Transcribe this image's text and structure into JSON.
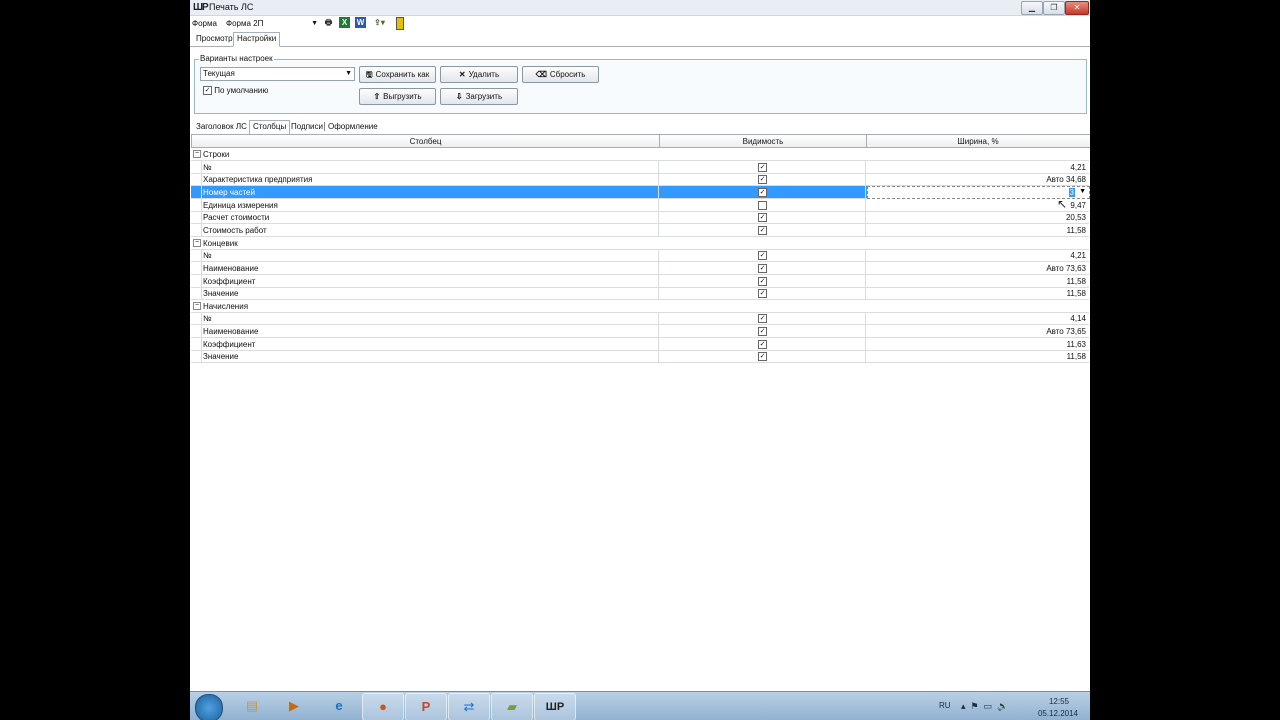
{
  "window": {
    "title": "Печать ЛС",
    "app_icon": "ШР"
  },
  "form_row": {
    "label": "Форма",
    "selected": "Форма 2П"
  },
  "toolbar_icons": [
    "printer-icon",
    "excel-icon",
    "word-icon",
    "export-icon",
    "bookmark-icon"
  ],
  "top_tabs": [
    {
      "label": "Просмотр",
      "active": false
    },
    {
      "label": "Настройки",
      "active": true
    }
  ],
  "settings": {
    "group_title": "Варианты настроек",
    "variant_value": "Текущая",
    "default_label": "По умолчанию",
    "default_checked": true,
    "buttons": {
      "save_as": "Сохранить как",
      "delete": "Удалить",
      "reset": "Сбросить",
      "export": "Выгрузить",
      "import": "Загрузить"
    }
  },
  "inner_tabs": [
    {
      "label": "Заголовок ЛС",
      "active": false
    },
    {
      "label": "Столбцы",
      "active": true
    },
    {
      "label": "Подписи",
      "active": false
    },
    {
      "label": "Оформление",
      "active": false
    }
  ],
  "grid": {
    "columns": [
      "Столбец",
      "Видимость",
      "Ширина, %"
    ],
    "groups": [
      {
        "name": "Строки",
        "rows": [
          {
            "name": "№",
            "visible": true,
            "width": "4,21"
          },
          {
            "name": "Характеристика предприятия",
            "visible": true,
            "width": "Авто 34,68"
          },
          {
            "name": "Номер частей",
            "visible": true,
            "width": "3",
            "selected": true
          },
          {
            "name": "Единица измерения",
            "visible": false,
            "width": "9,47"
          },
          {
            "name": "Расчет стоимости",
            "visible": true,
            "width": "20,53"
          },
          {
            "name": "Стоимость работ",
            "visible": true,
            "width": "11,58"
          }
        ]
      },
      {
        "name": "Концевик",
        "rows": [
          {
            "name": "№",
            "visible": true,
            "width": "4,21"
          },
          {
            "name": "Наименование",
            "visible": true,
            "width": "Авто 73,63"
          },
          {
            "name": "Коэффициент",
            "visible": true,
            "width": "11,58"
          },
          {
            "name": "Значение",
            "visible": true,
            "width": "11,58"
          }
        ]
      },
      {
        "name": "Начисления",
        "rows": [
          {
            "name": "№",
            "visible": true,
            "width": "4,14"
          },
          {
            "name": "Наименование",
            "visible": true,
            "width": "Авто 73,65"
          },
          {
            "name": "Коэффициент",
            "visible": true,
            "width": "11,63"
          },
          {
            "name": "Значение",
            "visible": true,
            "width": "11,58"
          }
        ]
      }
    ]
  },
  "taskbar": {
    "apps": [
      "explorer-icon",
      "media-player-icon",
      "internet-explorer-icon",
      "firefox-icon",
      "powerpoint-icon",
      "teamviewer-icon",
      "notes-icon",
      "print-app-icon"
    ],
    "lang": "RU",
    "time": "12:55",
    "date": "05.12.2014"
  }
}
